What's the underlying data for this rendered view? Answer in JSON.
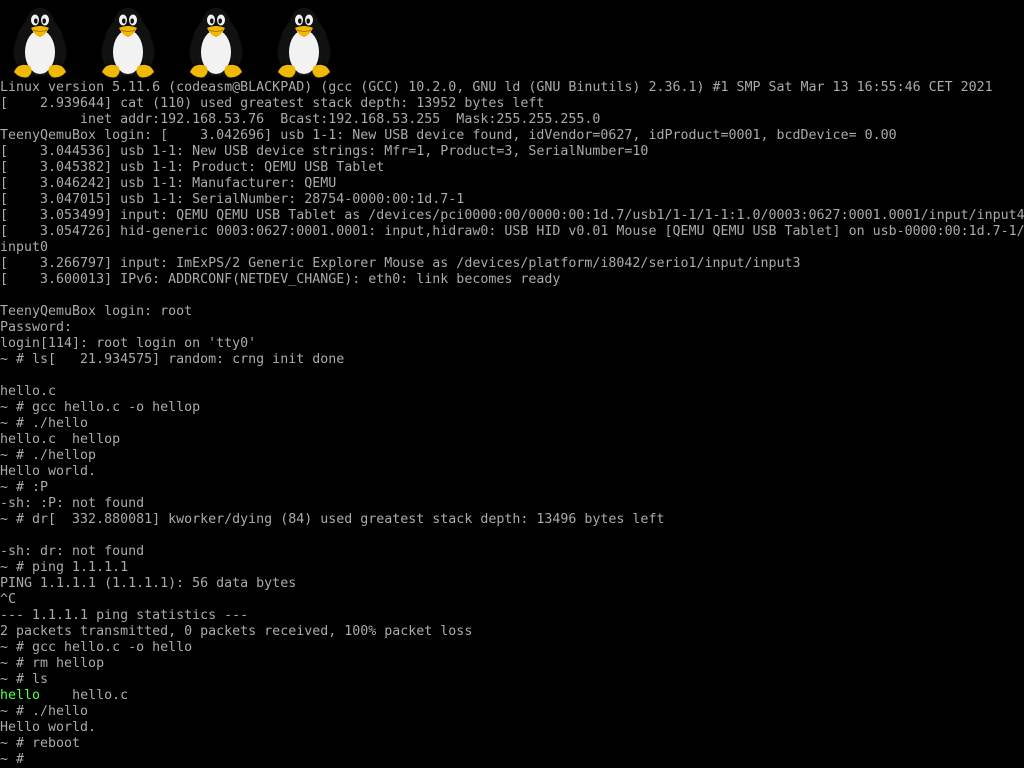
{
  "console": {
    "logo_count": 4,
    "colors": {
      "background": "#000000",
      "text": "#aaaaaa",
      "executable": "#55ff55"
    },
    "lines": [
      "Linux version 5.11.6 (codeasm@BLACKPAD) (gcc (GCC) 10.2.0, GNU ld (GNU Binutils) 2.36.1) #1 SMP Sat Mar 13 16:55:46 CET 2021",
      "[    2.939644] cat (110) used greatest stack depth: 13952 bytes left",
      "          inet addr:192.168.53.76  Bcast:192.168.53.255  Mask:255.255.255.0",
      "TeenyQemuBox login: [    3.042696] usb 1-1: New USB device found, idVendor=0627, idProduct=0001, bcdDevice= 0.00",
      "[    3.044536] usb 1-1: New USB device strings: Mfr=1, Product=3, SerialNumber=10",
      "[    3.045382] usb 1-1: Product: QEMU USB Tablet",
      "[    3.046242] usb 1-1: Manufacturer: QEMU",
      "[    3.047015] usb 1-1: SerialNumber: 28754-0000:00:1d.7-1",
      "[    3.053499] input: QEMU QEMU USB Tablet as /devices/pci0000:00/0000:00:1d.7/usb1/1-1/1-1:1.0/0003:0627:0001.0001/input/input4",
      "[    3.054726] hid-generic 0003:0627:0001.0001: input,hidraw0: USB HID v0.01 Mouse [QEMU QEMU USB Tablet] on usb-0000:00:1d.7-1/",
      "input0",
      "[    3.266797] input: ImExPS/2 Generic Explorer Mouse as /devices/platform/i8042/serio1/input/input3",
      "[    3.600013] IPv6: ADDRCONF(NETDEV_CHANGE): eth0: link becomes ready",
      "",
      "TeenyQemuBox login: root",
      "Password:",
      "login[114]: root login on 'tty0'",
      "~ # ls[   21.934575] random: crng init done",
      "",
      "hello.c",
      "~ # gcc hello.c -o hellop",
      "~ # ./hello",
      "hello.c  hellop",
      "~ # ./hellop",
      "Hello world.",
      "~ # :P",
      "-sh: :P: not found",
      "~ # dr[  332.880081] kworker/dying (84) used greatest stack depth: 13496 bytes left",
      "",
      "-sh: dr: not found",
      "~ # ping 1.1.1.1",
      "PING 1.1.1.1 (1.1.1.1): 56 data bytes",
      "^C",
      "--- 1.1.1.1 ping statistics ---",
      "2 packets transmitted, 0 packets received, 100% packet loss",
      "~ # gcc hello.c -o hello",
      "~ # rm hellop",
      "~ # ls",
      "",
      "~ # ./hello",
      "Hello world.",
      "~ # reboot",
      "~ # "
    ],
    "ls_listing": {
      "executable": "hello",
      "separator": "    ",
      "file": "hello.c"
    }
  }
}
